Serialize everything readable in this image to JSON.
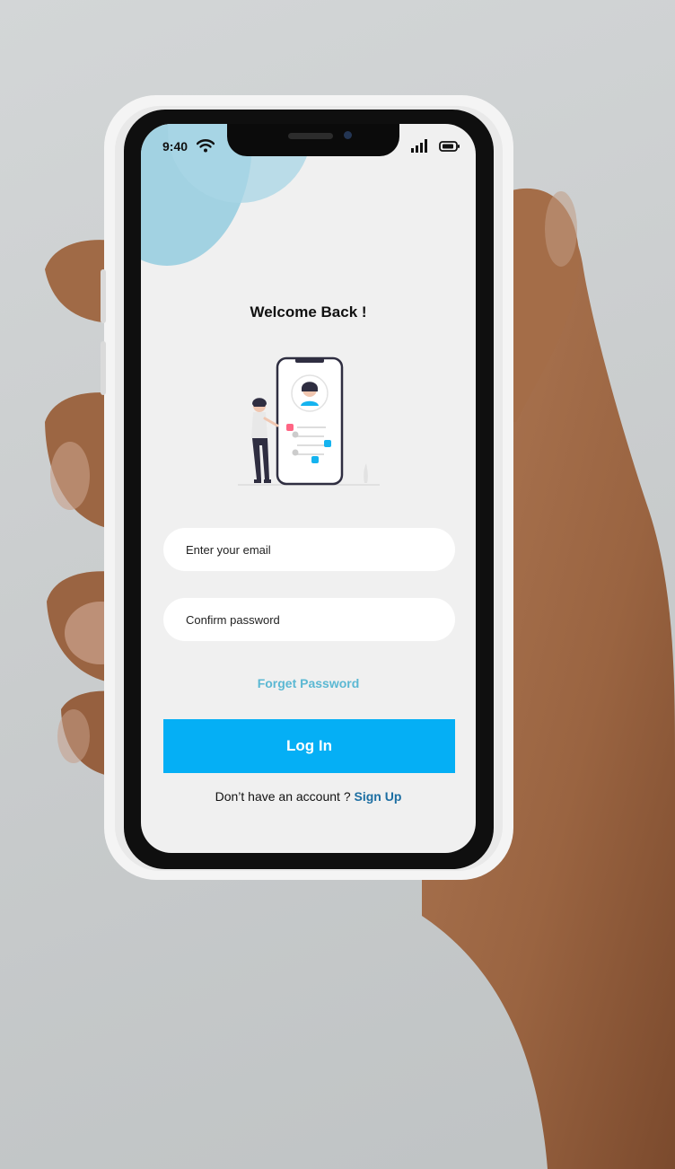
{
  "status_bar": {
    "time": "9:40",
    "icons": [
      "wifi-icon",
      "signal-icon",
      "battery-icon"
    ]
  },
  "login": {
    "title": "Welcome Back !",
    "email_placeholder": "Enter your email",
    "password_placeholder": "Confirm password",
    "forgot_label": "Forget Password",
    "login_label": "Log In",
    "signup_prompt": "Don’t have an account  ?",
    "signup_label": "Sign Up"
  },
  "colors": {
    "primary": "#05aff5",
    "link": "#5bb8d3",
    "signup_link": "#1c6ea2",
    "blob": "#9dd0e0",
    "screen_bg": "#f0f0f0"
  }
}
